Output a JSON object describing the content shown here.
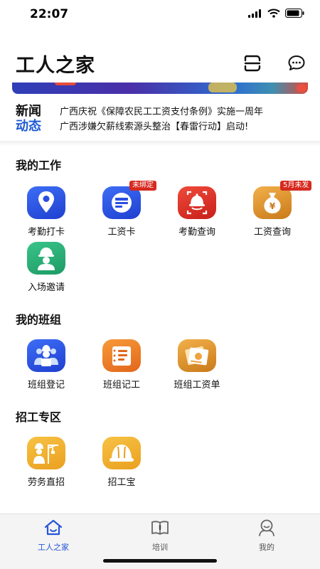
{
  "status_bar": {
    "time": "22:07"
  },
  "header": {
    "title": "工人之家"
  },
  "news": {
    "logo_line1": "新闻",
    "logo_line2": "动态",
    "items": [
      "广西庆祝《保障农民工工资支付条例》实施一周年",
      "广西涉嫌欠薪线索源头整治【春雷行动】启动!"
    ]
  },
  "sections": {
    "work": {
      "title": "我的工作",
      "items": [
        {
          "label": "考勤打卡",
          "icon": "location-pin-icon"
        },
        {
          "label": "工资卡",
          "icon": "bank-card-icon",
          "badge": "未绑定"
        },
        {
          "label": "考勤查询",
          "icon": "face-scan-helmet-icon"
        },
        {
          "label": "工资查询",
          "icon": "money-bag-icon",
          "badge": "5月未发"
        },
        {
          "label": "入场邀请",
          "icon": "worker-helmet-icon"
        }
      ]
    },
    "team": {
      "title": "我的班组",
      "items": [
        {
          "label": "班组登记",
          "icon": "team-group-icon"
        },
        {
          "label": "班组记工",
          "icon": "ledger-icon"
        },
        {
          "label": "班组工资单",
          "icon": "payslip-icon"
        }
      ]
    },
    "recruit": {
      "title": "招工专区",
      "items": [
        {
          "label": "劳务直招",
          "icon": "worker-crane-icon"
        },
        {
          "label": "招工宝",
          "icon": "hard-hat-icon"
        }
      ]
    }
  },
  "tabbar": {
    "tabs": [
      {
        "label": "工人之家",
        "icon": "home-icon",
        "active": true
      },
      {
        "label": "培训",
        "icon": "book-icon",
        "active": false
      },
      {
        "label": "我的",
        "icon": "profile-icon",
        "active": false
      }
    ]
  },
  "colors": {
    "accent": "#2456d8",
    "badge": "#d62a1f"
  }
}
